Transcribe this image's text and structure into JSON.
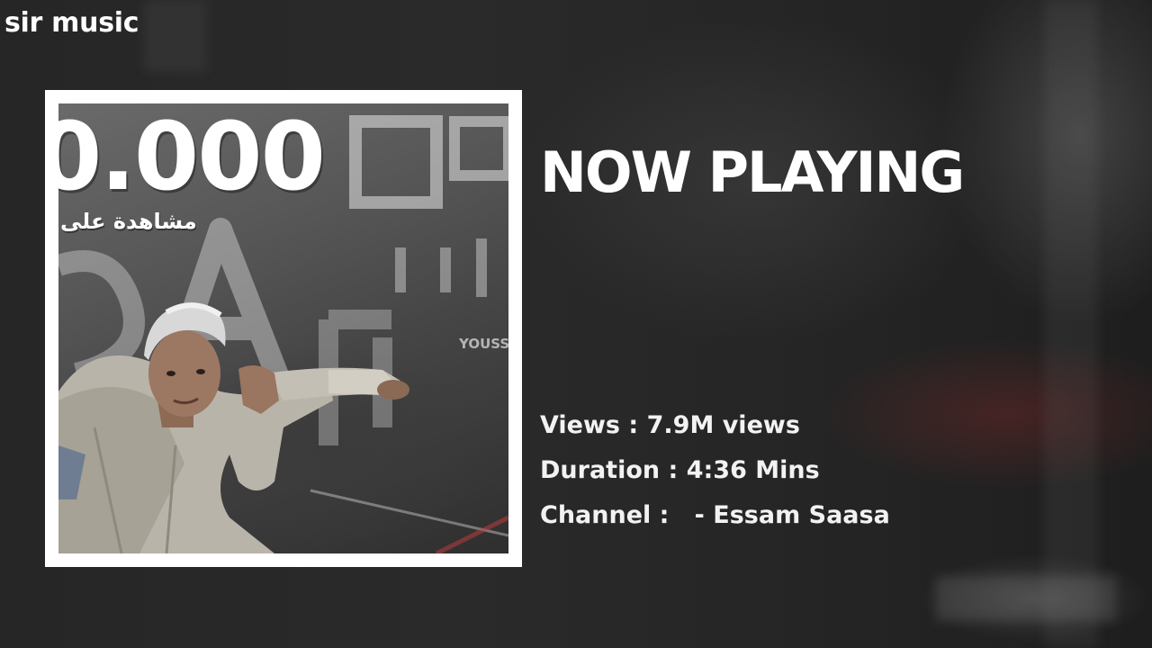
{
  "app": {
    "brand": "sir music"
  },
  "now_playing": {
    "heading": "NOW PLAYING"
  },
  "cover": {
    "number_text": "0.000",
    "arabic_text": "مشاهدة على",
    "description": "album artwork: man with bleached hair in denim jacket leaning on a wall with graffiti lettering"
  },
  "details": {
    "views_label": "Views : ",
    "views_value": "7.9M views",
    "duration_label": "Duration : ",
    "duration_value": "4:36 Mins",
    "channel_label": "Channel :   ",
    "channel_value": "- Essam Saasa"
  },
  "colors": {
    "background": "#262626",
    "text": "#ffffff",
    "frame": "#ffffff"
  }
}
